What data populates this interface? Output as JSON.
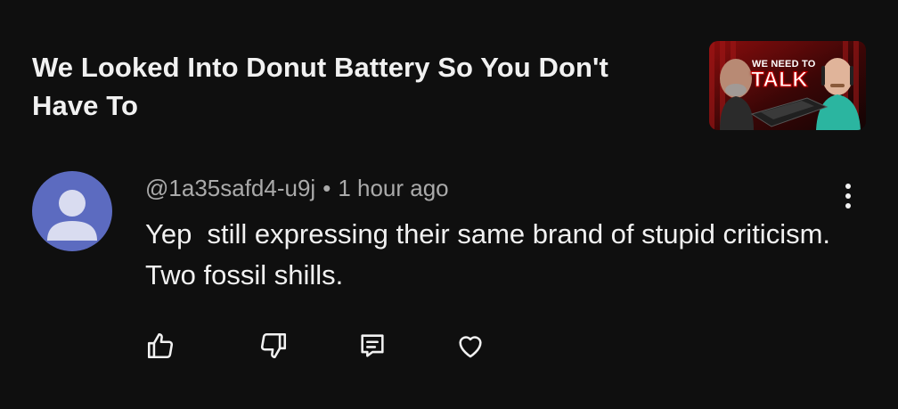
{
  "video": {
    "title": "We Looked Into Donut Battery So You Don't Have To",
    "thumbnail": {
      "line1": "WE NEED TO",
      "line2": "TALK",
      "accent": "#e02020"
    }
  },
  "comment": {
    "author": "@1a35safd4-u9j",
    "separator": "•",
    "time": "1 hour ago",
    "text": "Yep  still expressing their same brand of stupid criticism.  Two fossil shills.",
    "avatar_color": "#5c6bc0"
  },
  "actions": {
    "like_icon": "thumb-up-icon",
    "dislike_icon": "thumb-down-icon",
    "reply_icon": "comment-icon",
    "heart_icon": "heart-icon",
    "more_icon": "more-vertical-icon"
  }
}
